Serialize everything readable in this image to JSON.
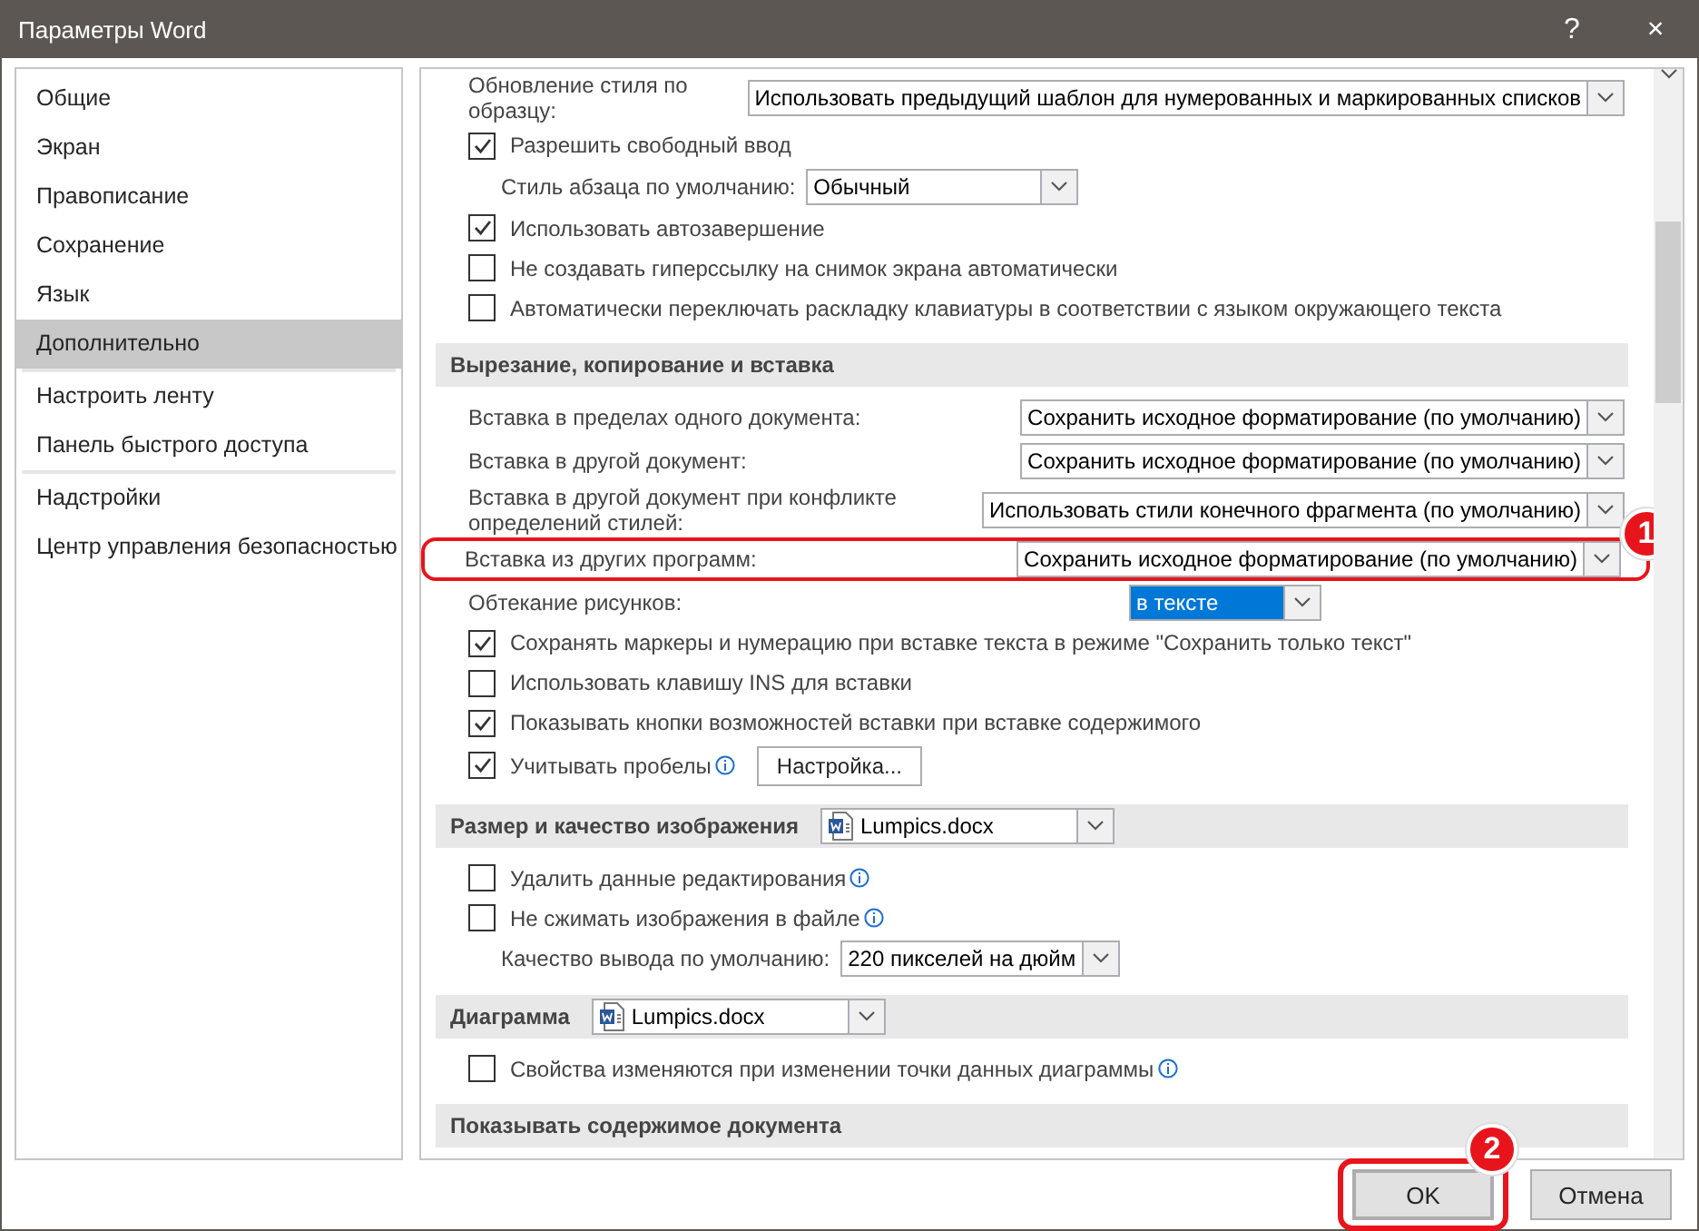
{
  "window": {
    "title": "Параметры Word",
    "help": "?",
    "close": "×"
  },
  "sidebar": {
    "groups": [
      [
        {
          "label": "Общие",
          "selected": false
        },
        {
          "label": "Экран",
          "selected": false
        },
        {
          "label": "Правописание",
          "selected": false
        },
        {
          "label": "Сохранение",
          "selected": false
        },
        {
          "label": "Язык",
          "selected": false
        },
        {
          "label": "Дополнительно",
          "selected": true
        }
      ],
      [
        {
          "label": "Настроить ленту",
          "selected": false
        },
        {
          "label": "Панель быстрого доступа",
          "selected": false
        }
      ],
      [
        {
          "label": "Надстройки",
          "selected": false
        },
        {
          "label": "Центр управления безопасностью",
          "selected": false
        }
      ]
    ]
  },
  "sections": [
    {
      "rows": [
        {
          "kind": "select",
          "label": "Обновление стиля по образцу:",
          "value": "Использовать предыдущий шаблон для нумерованных и маркированных списков"
        },
        {
          "kind": "checkbox",
          "label": "Разрешить свободный ввод",
          "checked": true
        },
        {
          "kind": "select_inline",
          "label": "Стиль абзаца по умолчанию:",
          "value": "Обычный"
        },
        {
          "kind": "checkbox",
          "label": "Использовать автозавершение",
          "checked": true
        },
        {
          "kind": "checkbox",
          "label": "Не создавать гиперссылку на снимок экрана автоматически",
          "checked": false
        },
        {
          "kind": "checkbox",
          "label": "Автоматически переключать раскладку клавиатуры в соответствии с языком окружающего текста",
          "checked": false
        }
      ]
    },
    {
      "title": "Вырезание, копирование и вставка",
      "rows": [
        {
          "kind": "select",
          "label": "Вставка в пределах одного документа:",
          "value": "Сохранить исходное форматирование (по умолчанию)"
        },
        {
          "kind": "select",
          "label": "Вставка в другой документ:",
          "value": "Сохранить исходное форматирование (по умолчанию)"
        },
        {
          "kind": "select",
          "label": "Вставка в другой документ при конфликте определений стилей:",
          "value": "Использовать стили конечного фрагмента (по умолчанию)"
        },
        {
          "kind": "select",
          "label": "Вставка из других программ:",
          "value": "Сохранить исходное форматирование (по умолчанию)",
          "highlighted": true,
          "marker": "1"
        },
        {
          "kind": "select_mid",
          "label": "Обтекание рисунков:",
          "value": "в тексте",
          "focused": true
        },
        {
          "kind": "checkbox",
          "label": "Сохранять маркеры и нумерацию при вставке текста в режиме \"Сохранить только текст\"",
          "checked": true
        },
        {
          "kind": "checkbox",
          "label": "Использовать клавишу INS для вставки",
          "checked": false
        },
        {
          "kind": "checkbox",
          "label": "Показывать кнопки возможностей вставки при вставке содержимого",
          "checked": true
        },
        {
          "kind": "checkbox",
          "label": "Учитывать пробелы",
          "checked": true,
          "info": true,
          "button": "Настройка..."
        }
      ]
    },
    {
      "title": "Размер и качество изображения",
      "document": "Lumpics.docx",
      "rows": [
        {
          "kind": "checkbox",
          "label": "Удалить данные редактирования",
          "checked": false,
          "info": true
        },
        {
          "kind": "checkbox",
          "label": "Не сжимать изображения в файле",
          "checked": false,
          "info": true
        },
        {
          "kind": "select_inline",
          "label": "Качество вывода по умолчанию:",
          "value": "220 пикселей на дюйм"
        }
      ]
    },
    {
      "title": "Диаграмма",
      "document": "Lumpics.docx",
      "rows": [
        {
          "kind": "checkbox",
          "label": "Свойства изменяются при изменении точки данных диаграммы",
          "checked": false,
          "info": true
        }
      ]
    },
    {
      "title": "Показывать содержимое документа"
    }
  ],
  "footer": {
    "buttons": [
      {
        "label": "OK",
        "highlighted": true,
        "marker": "2"
      },
      {
        "label": "Отмена",
        "highlighted": false
      }
    ]
  }
}
